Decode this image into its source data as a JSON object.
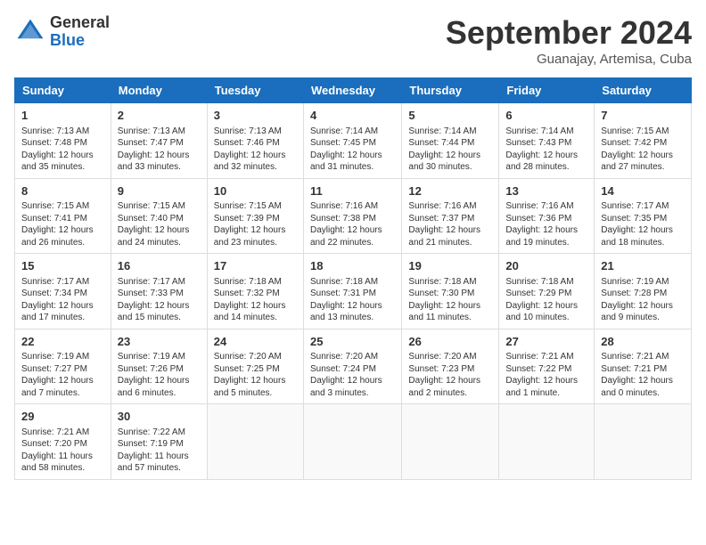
{
  "header": {
    "logo_general": "General",
    "logo_blue": "Blue",
    "month_title": "September 2024",
    "subtitle": "Guanajay, Artemisa, Cuba"
  },
  "weekdays": [
    "Sunday",
    "Monday",
    "Tuesday",
    "Wednesday",
    "Thursday",
    "Friday",
    "Saturday"
  ],
  "weeks": [
    [
      {
        "day": "1",
        "sunrise": "Sunrise: 7:13 AM",
        "sunset": "Sunset: 7:48 PM",
        "daylight": "Daylight: 12 hours and 35 minutes."
      },
      {
        "day": "2",
        "sunrise": "Sunrise: 7:13 AM",
        "sunset": "Sunset: 7:47 PM",
        "daylight": "Daylight: 12 hours and 33 minutes."
      },
      {
        "day": "3",
        "sunrise": "Sunrise: 7:13 AM",
        "sunset": "Sunset: 7:46 PM",
        "daylight": "Daylight: 12 hours and 32 minutes."
      },
      {
        "day": "4",
        "sunrise": "Sunrise: 7:14 AM",
        "sunset": "Sunset: 7:45 PM",
        "daylight": "Daylight: 12 hours and 31 minutes."
      },
      {
        "day": "5",
        "sunrise": "Sunrise: 7:14 AM",
        "sunset": "Sunset: 7:44 PM",
        "daylight": "Daylight: 12 hours and 30 minutes."
      },
      {
        "day": "6",
        "sunrise": "Sunrise: 7:14 AM",
        "sunset": "Sunset: 7:43 PM",
        "daylight": "Daylight: 12 hours and 28 minutes."
      },
      {
        "day": "7",
        "sunrise": "Sunrise: 7:15 AM",
        "sunset": "Sunset: 7:42 PM",
        "daylight": "Daylight: 12 hours and 27 minutes."
      }
    ],
    [
      {
        "day": "8",
        "sunrise": "Sunrise: 7:15 AM",
        "sunset": "Sunset: 7:41 PM",
        "daylight": "Daylight: 12 hours and 26 minutes."
      },
      {
        "day": "9",
        "sunrise": "Sunrise: 7:15 AM",
        "sunset": "Sunset: 7:40 PM",
        "daylight": "Daylight: 12 hours and 24 minutes."
      },
      {
        "day": "10",
        "sunrise": "Sunrise: 7:15 AM",
        "sunset": "Sunset: 7:39 PM",
        "daylight": "Daylight: 12 hours and 23 minutes."
      },
      {
        "day": "11",
        "sunrise": "Sunrise: 7:16 AM",
        "sunset": "Sunset: 7:38 PM",
        "daylight": "Daylight: 12 hours and 22 minutes."
      },
      {
        "day": "12",
        "sunrise": "Sunrise: 7:16 AM",
        "sunset": "Sunset: 7:37 PM",
        "daylight": "Daylight: 12 hours and 21 minutes."
      },
      {
        "day": "13",
        "sunrise": "Sunrise: 7:16 AM",
        "sunset": "Sunset: 7:36 PM",
        "daylight": "Daylight: 12 hours and 19 minutes."
      },
      {
        "day": "14",
        "sunrise": "Sunrise: 7:17 AM",
        "sunset": "Sunset: 7:35 PM",
        "daylight": "Daylight: 12 hours and 18 minutes."
      }
    ],
    [
      {
        "day": "15",
        "sunrise": "Sunrise: 7:17 AM",
        "sunset": "Sunset: 7:34 PM",
        "daylight": "Daylight: 12 hours and 17 minutes."
      },
      {
        "day": "16",
        "sunrise": "Sunrise: 7:17 AM",
        "sunset": "Sunset: 7:33 PM",
        "daylight": "Daylight: 12 hours and 15 minutes."
      },
      {
        "day": "17",
        "sunrise": "Sunrise: 7:18 AM",
        "sunset": "Sunset: 7:32 PM",
        "daylight": "Daylight: 12 hours and 14 minutes."
      },
      {
        "day": "18",
        "sunrise": "Sunrise: 7:18 AM",
        "sunset": "Sunset: 7:31 PM",
        "daylight": "Daylight: 12 hours and 13 minutes."
      },
      {
        "day": "19",
        "sunrise": "Sunrise: 7:18 AM",
        "sunset": "Sunset: 7:30 PM",
        "daylight": "Daylight: 12 hours and 11 minutes."
      },
      {
        "day": "20",
        "sunrise": "Sunrise: 7:18 AM",
        "sunset": "Sunset: 7:29 PM",
        "daylight": "Daylight: 12 hours and 10 minutes."
      },
      {
        "day": "21",
        "sunrise": "Sunrise: 7:19 AM",
        "sunset": "Sunset: 7:28 PM",
        "daylight": "Daylight: 12 hours and 9 minutes."
      }
    ],
    [
      {
        "day": "22",
        "sunrise": "Sunrise: 7:19 AM",
        "sunset": "Sunset: 7:27 PM",
        "daylight": "Daylight: 12 hours and 7 minutes."
      },
      {
        "day": "23",
        "sunrise": "Sunrise: 7:19 AM",
        "sunset": "Sunset: 7:26 PM",
        "daylight": "Daylight: 12 hours and 6 minutes."
      },
      {
        "day": "24",
        "sunrise": "Sunrise: 7:20 AM",
        "sunset": "Sunset: 7:25 PM",
        "daylight": "Daylight: 12 hours and 5 minutes."
      },
      {
        "day": "25",
        "sunrise": "Sunrise: 7:20 AM",
        "sunset": "Sunset: 7:24 PM",
        "daylight": "Daylight: 12 hours and 3 minutes."
      },
      {
        "day": "26",
        "sunrise": "Sunrise: 7:20 AM",
        "sunset": "Sunset: 7:23 PM",
        "daylight": "Daylight: 12 hours and 2 minutes."
      },
      {
        "day": "27",
        "sunrise": "Sunrise: 7:21 AM",
        "sunset": "Sunset: 7:22 PM",
        "daylight": "Daylight: 12 hours and 1 minute."
      },
      {
        "day": "28",
        "sunrise": "Sunrise: 7:21 AM",
        "sunset": "Sunset: 7:21 PM",
        "daylight": "Daylight: 12 hours and 0 minutes."
      }
    ],
    [
      {
        "day": "29",
        "sunrise": "Sunrise: 7:21 AM",
        "sunset": "Sunset: 7:20 PM",
        "daylight": "Daylight: 11 hours and 58 minutes."
      },
      {
        "day": "30",
        "sunrise": "Sunrise: 7:22 AM",
        "sunset": "Sunset: 7:19 PM",
        "daylight": "Daylight: 11 hours and 57 minutes."
      },
      null,
      null,
      null,
      null,
      null
    ]
  ]
}
